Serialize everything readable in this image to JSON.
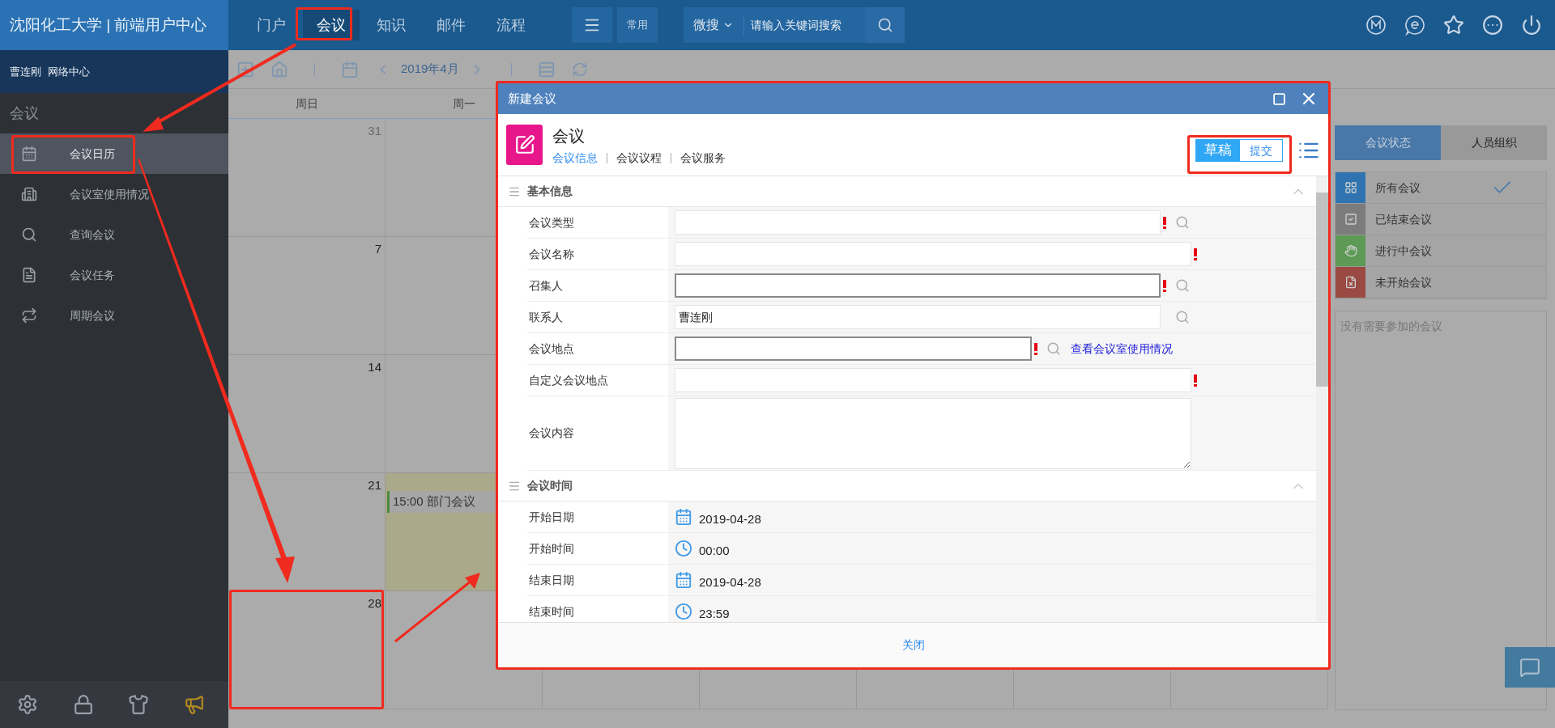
{
  "header": {
    "brand": "沈阳化工大学 | 前端用户中心",
    "nav": [
      {
        "label": "门户",
        "selected": false
      },
      {
        "label": "会议",
        "selected": true
      },
      {
        "label": "知识",
        "selected": false
      },
      {
        "label": "邮件",
        "selected": false
      },
      {
        "label": "流程",
        "selected": false
      }
    ],
    "common_button": "常用",
    "search": {
      "scope": "微搜",
      "placeholder": "请输入关键词搜索"
    }
  },
  "sidebar": {
    "user": "曹连刚",
    "department": "网络中心",
    "section_title": "会议",
    "items": [
      {
        "label": "会议日历",
        "selected": true
      },
      {
        "label": "会议室使用情况",
        "selected": false
      },
      {
        "label": "查询会议",
        "selected": false
      },
      {
        "label": "会议任务",
        "selected": false
      },
      {
        "label": "周期会议",
        "selected": false
      }
    ]
  },
  "toolbar": {
    "month": "2019年4月"
  },
  "calendar": {
    "weekdays": [
      "周日",
      "周一"
    ],
    "weeks": [
      {
        "cells": [
          {
            "day": "31",
            "muted": true,
            "highlighted": false
          }
        ]
      },
      {
        "cells": [
          {
            "day": "7",
            "muted": false,
            "highlighted": false
          }
        ]
      },
      {
        "cells": [
          {
            "day": "14",
            "muted": false,
            "highlighted": false
          }
        ]
      },
      {
        "cells": [
          {
            "day": "21",
            "muted": false,
            "highlighted": false
          },
          {
            "highlighted": true,
            "events": [
              "15:00 部门会议"
            ]
          }
        ]
      },
      {
        "cells": [
          {
            "day": "28",
            "muted": false,
            "highlighted": false
          }
        ]
      }
    ]
  },
  "right_panel": {
    "tabs": [
      {
        "label": "会议状态",
        "selected": true
      },
      {
        "label": "人员组织",
        "selected": false
      }
    ],
    "statuses": [
      {
        "label": "所有会议",
        "color": "#2f74b0",
        "selected": true
      },
      {
        "label": "已结束会议",
        "color": "#7c7c7c",
        "selected": false
      },
      {
        "label": "进行中会议",
        "color": "#5c9a55",
        "selected": false
      },
      {
        "label": "未开始会议",
        "color": "#9a4a42",
        "selected": false
      }
    ],
    "empty_message": "没有需要参加的会议"
  },
  "dialog": {
    "title": "新建会议",
    "form_title": "会议",
    "tabs": [
      {
        "label": "会议信息",
        "selected": true
      },
      {
        "label": "会议议程",
        "selected": false
      },
      {
        "label": "会议服务",
        "selected": false
      }
    ],
    "modes": [
      {
        "label": "草稿",
        "selected": true
      },
      {
        "label": "提交",
        "selected": false
      }
    ],
    "sections": [
      {
        "title": "基本信息",
        "expanded": true,
        "fields": [
          {
            "label": "会议类型",
            "kind": "input",
            "required": true,
            "lookup": true,
            "bordered": false
          },
          {
            "label": "会议名称",
            "kind": "input",
            "required": true,
            "lookup": false,
            "bordered": false
          },
          {
            "label": "召集人",
            "kind": "input",
            "required": true,
            "lookup": true,
            "bordered": true
          },
          {
            "label": "联系人",
            "kind": "input",
            "value": "曹连刚",
            "required": false,
            "lookup": true,
            "bordered": false
          },
          {
            "label": "会议地点",
            "kind": "input",
            "required": true,
            "lookup": true,
            "bordered": true,
            "link": "查看会议室使用情况"
          },
          {
            "label": "自定义会议地点",
            "kind": "input",
            "required": true,
            "lookup": false,
            "bordered": false
          },
          {
            "label": "会议内容",
            "kind": "textarea"
          }
        ]
      },
      {
        "title": "会议时间",
        "expanded": true,
        "fields": [
          {
            "label": "开始日期",
            "kind": "date",
            "value": "2019-04-28"
          },
          {
            "label": "开始时间",
            "kind": "time",
            "value": "00:00"
          },
          {
            "label": "结束日期",
            "kind": "date",
            "value": "2019-04-28"
          },
          {
            "label": "结束时间",
            "kind": "time",
            "value": "23:59"
          }
        ]
      }
    ],
    "close_button": "关闭"
  }
}
